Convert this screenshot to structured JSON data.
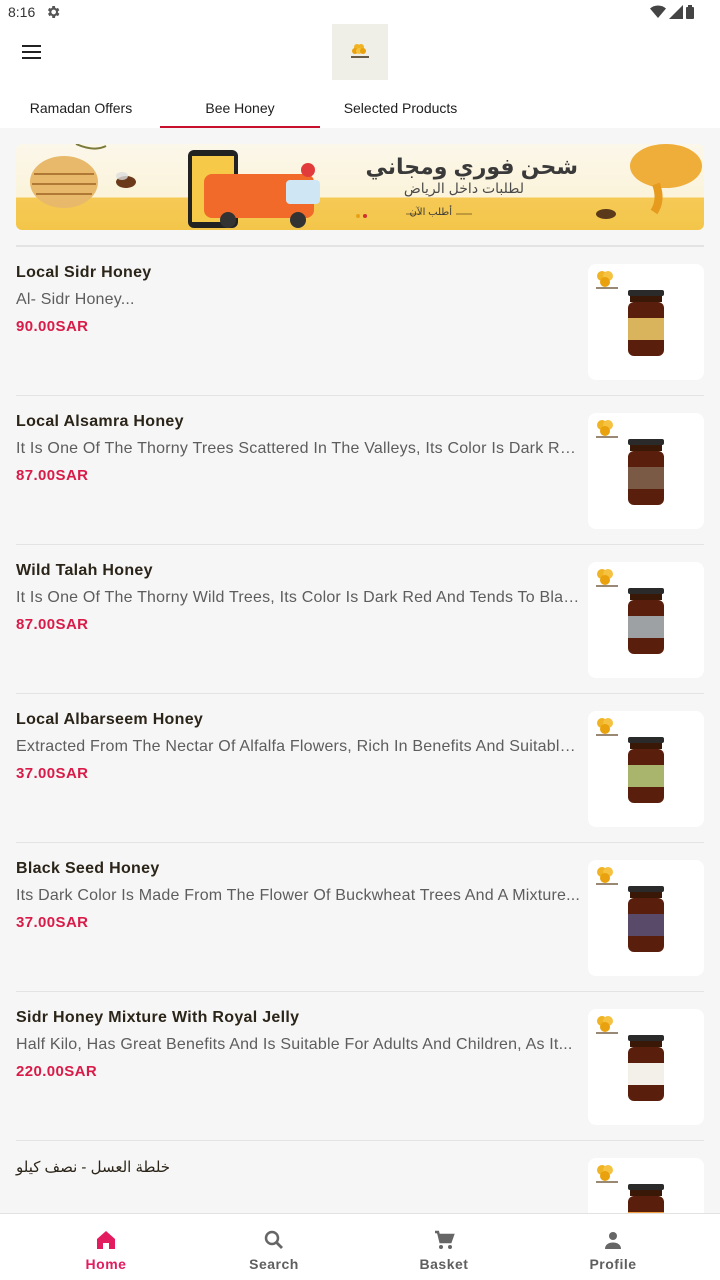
{
  "status_bar": {
    "time": "8:16",
    "settings_icon": "gear-icon",
    "wifi_icon": "wifi-icon",
    "signal_icon": "signal-icon",
    "battery_icon": "battery-icon"
  },
  "header": {
    "menu_icon": "menu-icon",
    "logo_icon": "brand-logo"
  },
  "tabs": [
    {
      "label": "Ramadan Offers",
      "active": false
    },
    {
      "label": "Bee Honey",
      "active": true
    },
    {
      "label": "Selected Products",
      "active": false
    }
  ],
  "banner": {
    "title": "شحن فوري ومجاني",
    "subtitle": "لطلبات داخل الرياض",
    "cta": "أطلب الآن"
  },
  "products": [
    {
      "name": "Local Sidr Honey",
      "description": "Al- Sidr Honey...",
      "price": "90.00SAR",
      "label_color": "#d9b45c"
    },
    {
      "name": "Local Alsamra Honey",
      "description": "It Is One Of The Thorny Trees Scattered In The Valleys, Its Color Is Dark Red...",
      "price": "87.00SAR",
      "label_color": "#7a5a44"
    },
    {
      "name": "Wild Talah Honey",
      "description": "It Is One Of The Thorny Wild Trees, Its Color Is Dark Red And Tends To Black...",
      "price": "87.00SAR",
      "label_color": "#9ea1a3"
    },
    {
      "name": "Local Albarseem Honey",
      "description": "Extracted From The Nectar Of Alfalfa Flowers, Rich In Benefits And Suitable...",
      "price": "37.00SAR",
      "label_color": "#a9b46c"
    },
    {
      "name": "Black Seed Honey",
      "description": "Its Dark Color Is Made From The Flower Of Buckwheat Trees And A Mixture...",
      "price": "37.00SAR",
      "label_color": "#5a4a6a"
    },
    {
      "name": "Sidr Honey Mixture With Royal Jelly",
      "description": "Half Kilo, Has Great Benefits And Is Suitable For Adults And Children, As It...",
      "price": "220.00SAR",
      "label_color": "#f3f0ea"
    },
    {
      "name": "خلطة العسل - نصف كيلو",
      "description": "",
      "price": "",
      "label_color": "#f0a040"
    }
  ],
  "bottom_nav": [
    {
      "label": "Home",
      "icon": "home-icon",
      "active": true
    },
    {
      "label": "Search",
      "icon": "search-icon",
      "active": false
    },
    {
      "label": "Basket",
      "icon": "cart-icon",
      "active": false
    },
    {
      "label": "Profile",
      "icon": "profile-icon",
      "active": false
    }
  ],
  "colors": {
    "accent": "#c8102e",
    "price": "#d81b48",
    "inactive": "#5f5f5f"
  }
}
